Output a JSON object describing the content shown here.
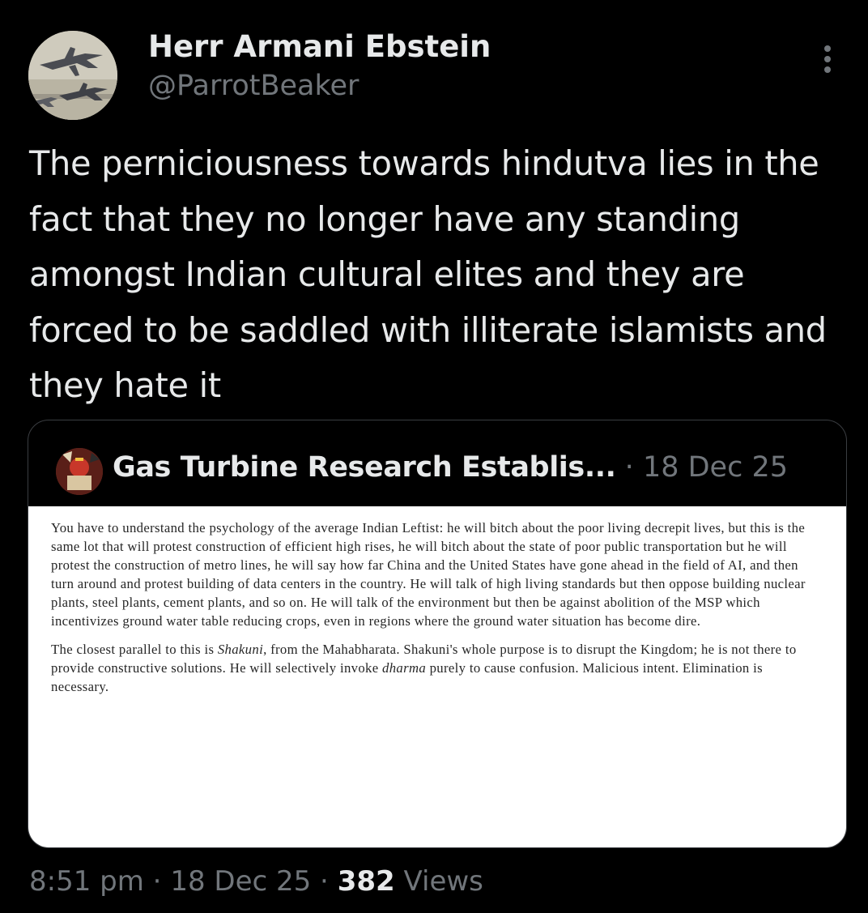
{
  "author": {
    "name": "Herr Armani Ebstein",
    "handle": "@ParrotBeaker"
  },
  "tweet": {
    "text": "The perniciousness towards hindutva lies in the fact that they no longer have any standing amongst Indian cultural elites and they are forced to be saddled with illiterate islamists and they hate it"
  },
  "quote": {
    "author_name": "Gas Turbine Research Establis...",
    "separator": "·",
    "date": "18 Dec 25",
    "image_text": {
      "paragraph_1": "You have to understand the psychology of the average Indian Leftist: he will bitch about the poor living decrepit lives, but this is the same lot that will protest construction of efficient high rises, he will bitch about the state of poor public transportation but he will protest the construction of metro lines, he will say how far China and the United States have gone ahead in the field of AI, and then turn around and protest building of data centers in the country. He will talk of high living standards but then oppose building nuclear plants, steel plants, cement plants, and so on. He will talk of the environment but then be against abolition of the MSP which incentivizes ground water table reducing crops, even in regions where the ground water situation has become dire.",
      "paragraph_2_a": "The closest parallel to this is ",
      "paragraph_2_shakuni": "Shakuni",
      "paragraph_2_b": ", from the Mahabharata. Shakuni's whole purpose is to disrupt the Kingdom; he is not there to provide constructive solutions. He will selectively invoke ",
      "paragraph_2_dharma": "dharma",
      "paragraph_2_c": " purely to cause confusion. Malicious intent. Elimination is necessary."
    }
  },
  "meta": {
    "time": "8:51 pm",
    "sep1": " · ",
    "date": "18 Dec 25",
    "sep2": " · ",
    "views_count": "382",
    "views_label": " Views"
  },
  "icons": {
    "more": "more-vertical-icon",
    "avatar": "fighter-jets-avatar",
    "quote_avatar": "quote-author-avatar"
  }
}
